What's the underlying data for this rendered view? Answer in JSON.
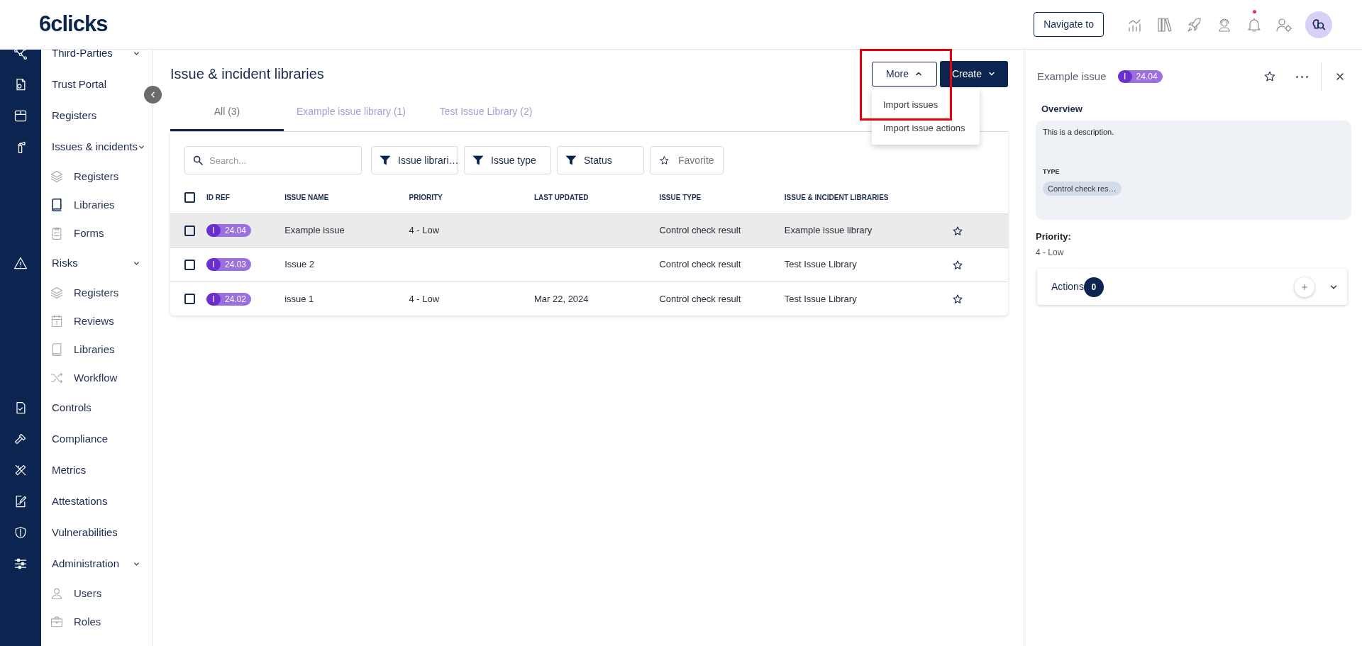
{
  "header": {
    "logo": "6clicks",
    "navigate_button": "Navigate to",
    "notification_unread": true
  },
  "sidebar": {
    "items": [
      {
        "label": "Third-Parties",
        "collapsible": true,
        "selected": false
      },
      {
        "label": "Trust Portal",
        "collapsible": false,
        "selected": false
      },
      {
        "label": "Registers",
        "collapsible": false,
        "selected": false
      },
      {
        "label": "Issues & incidents",
        "collapsible": true,
        "selected": false,
        "children": [
          {
            "label": "Registers",
            "selected": false
          },
          {
            "label": "Libraries",
            "selected": true
          },
          {
            "label": "Forms",
            "selected": false
          }
        ]
      },
      {
        "label": "Risks",
        "collapsible": true,
        "selected": false,
        "children": [
          {
            "label": "Registers",
            "selected": false
          },
          {
            "label": "Reviews",
            "selected": false
          },
          {
            "label": "Libraries",
            "selected": false
          },
          {
            "label": "Workflow",
            "selected": false
          }
        ]
      },
      {
        "label": "Controls",
        "collapsible": false,
        "selected": false
      },
      {
        "label": "Compliance",
        "collapsible": false,
        "selected": false
      },
      {
        "label": "Metrics",
        "collapsible": false,
        "selected": false
      },
      {
        "label": "Attestations",
        "collapsible": false,
        "selected": false
      },
      {
        "label": "Vulnerabilities",
        "collapsible": false,
        "selected": false
      },
      {
        "label": "Administration",
        "collapsible": true,
        "selected": false,
        "children": [
          {
            "label": "Users",
            "selected": false
          },
          {
            "label": "Roles",
            "selected": false
          }
        ]
      }
    ]
  },
  "page": {
    "title": "Issue & incident libraries",
    "more_button": {
      "label": "More",
      "expanded": true
    },
    "more_menu": [
      "Import issues",
      "Import issue actions"
    ],
    "create_button": "Create",
    "tabs": [
      {
        "label": "All (3)",
        "selected": true
      },
      {
        "label": "Example issue library (1)",
        "selected": false
      },
      {
        "label": "Test Issue Library (2)",
        "selected": false
      }
    ],
    "search": {
      "placeholder": "Search..."
    },
    "filters": [
      {
        "label": "Issue librari…",
        "kind": "filter"
      },
      {
        "label": "Issue type",
        "kind": "filter"
      },
      {
        "label": "Status",
        "kind": "filter"
      },
      {
        "label": "Favorite",
        "kind": "favorite"
      }
    ],
    "table": {
      "columns": [
        "ID REF",
        "ISSUE NAME",
        "PRIORITY",
        "LAST UPDATED",
        "ISSUE TYPE",
        "ISSUE & INCIDENT LIBRARIES"
      ],
      "header_checked": false,
      "rows": [
        {
          "selected": true,
          "checked": false,
          "id_prefix": "I",
          "id": "24.04",
          "name": "Example issue",
          "priority": "4 - Low",
          "issue_type": "Control check result",
          "library": "Example issue library",
          "favorite": false
        },
        {
          "selected": false,
          "checked": false,
          "id_prefix": "I",
          "id": "24.03",
          "name": "Issue 2",
          "issue_type": "Control check result",
          "library": "Test Issue Library",
          "favorite": false
        },
        {
          "selected": false,
          "checked": false,
          "id_prefix": "I",
          "id": "24.02",
          "name": "issue 1",
          "priority": "4 - Low",
          "last_updated": "Mar 22, 2024",
          "issue_type": "Control check result",
          "library": "Test Issue Library",
          "favorite": false
        }
      ]
    }
  },
  "detail_panel": {
    "title": "Example issue",
    "id_prefix": "I",
    "id": "24.04",
    "favorite": false,
    "overview_label": "Overview",
    "description": "This is a description.",
    "type_label": "TYPE",
    "type_chip": "Control check res…",
    "priority_label": "Priority:",
    "priority": "4 - Low",
    "actions": {
      "label": "Actions",
      "count": "0",
      "expanded": false
    }
  }
}
